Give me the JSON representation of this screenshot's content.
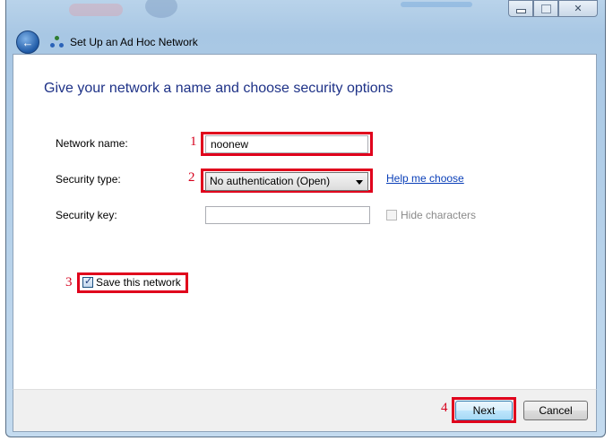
{
  "window": {
    "title": "Set Up an Ad Hoc Network",
    "caption_buttons": {
      "close_glyph": "✕"
    }
  },
  "main": {
    "heading": "Give your network a name and choose security options",
    "network_name": {
      "label": "Network name:",
      "value": "noonew"
    },
    "security_type": {
      "label": "Security type:",
      "value": "No authentication (Open)",
      "help_link": "Help me choose"
    },
    "security_key": {
      "label": "Security key:",
      "value": "",
      "hide_characters_label": "Hide characters"
    },
    "save_network": {
      "label": "Save this network",
      "checked": true
    }
  },
  "footer": {
    "next_label": "Next",
    "cancel_label": "Cancel"
  },
  "annotations": {
    "n1": "1",
    "n2": "2",
    "n3": "3",
    "n4": "4"
  },
  "colors": {
    "annotation_red": "#e0001c",
    "heading_blue": "#1e3287",
    "link_blue": "#0a3fb8"
  },
  "icons": {
    "back": "back-arrow-icon",
    "network": "ad-hoc-network-icon"
  }
}
